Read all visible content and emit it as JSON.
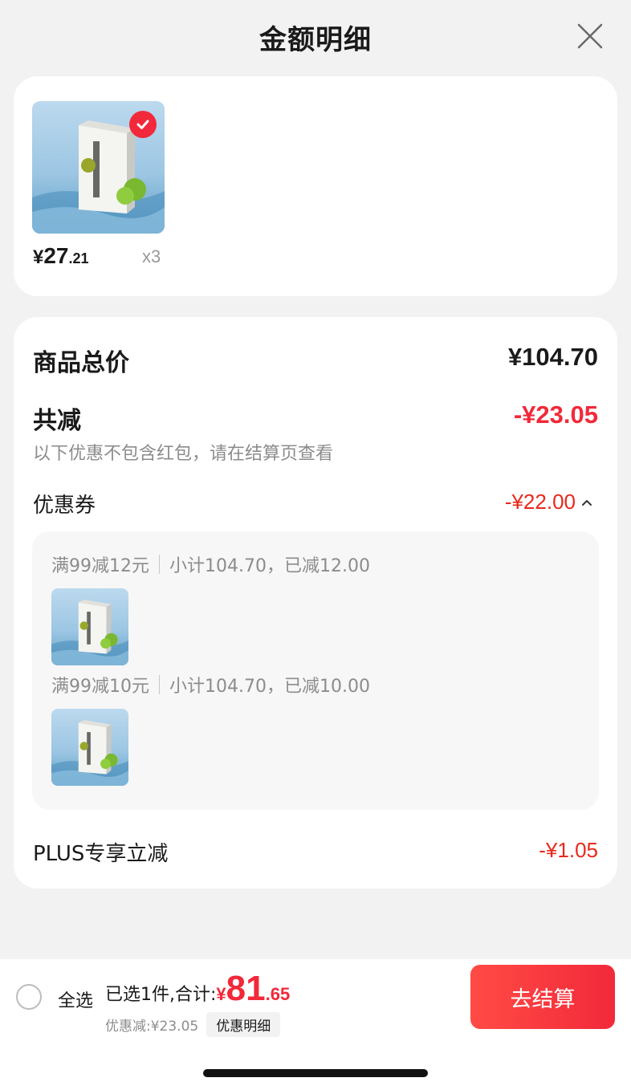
{
  "header": {
    "title": "金额明细"
  },
  "product": {
    "price_currency": "¥",
    "price_int": "27",
    "price_dec": ".21",
    "quantity": "x3",
    "selected": true,
    "image_icon": "coconut-water-carton-icon"
  },
  "detail": {
    "total_label": "商品总价",
    "total_value": "¥104.70",
    "savings_label": "共减",
    "savings_value": "-¥23.05",
    "note": "以下优惠不包含红包，请在结算页查看",
    "coupon_label": "优惠券",
    "coupon_value": "-¥22.00",
    "coupons": [
      {
        "rule": "满99减12元",
        "subtotal": "小计104.70，已减12.00"
      },
      {
        "rule": "满99减10元",
        "subtotal": "小计104.70，已减10.00"
      }
    ],
    "plus_label": "PLUS专享立减",
    "plus_value": "-¥1.05"
  },
  "bottom": {
    "select_all": "全选",
    "summary_label": "已选1件,合计:",
    "sum_currency": "¥",
    "sum_int": "81",
    "sum_dec": ".65",
    "discount_text": "优惠减:¥23.05",
    "discount_detail_btn": "优惠明细",
    "checkout": "去结算"
  },
  "colors": {
    "accent": "#f2293a",
    "muted": "#8c8c8c"
  }
}
